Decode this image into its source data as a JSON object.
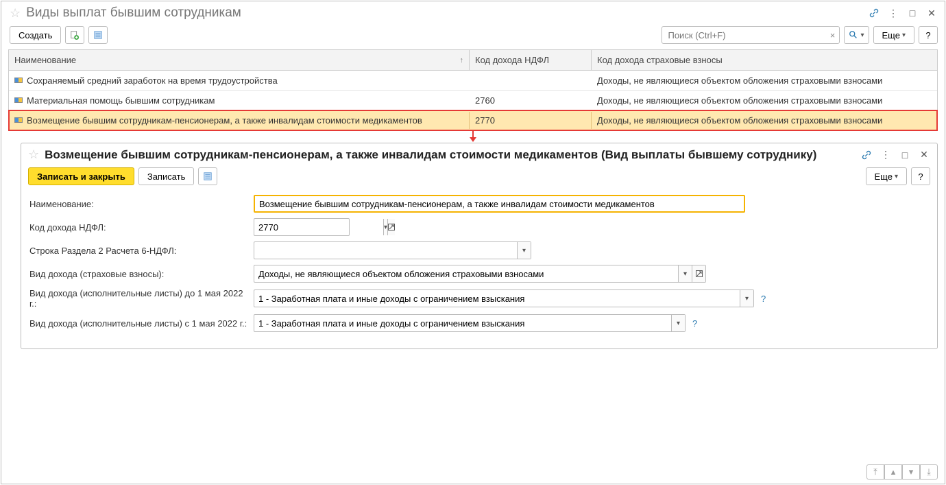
{
  "window": {
    "title": "Виды выплат бывшим сотрудникам",
    "create_label": "Создать",
    "search_placeholder": "Поиск (Ctrl+F)",
    "more_label": "Еще"
  },
  "table": {
    "headers": {
      "name": "Наименование",
      "ndfl": "Код дохода НДФЛ",
      "ins": "Код дохода страховые взносы"
    },
    "rows": [
      {
        "name": "Сохраняемый средний заработок на время трудоустройства",
        "ndfl": "",
        "ins": "Доходы, не являющиеся объектом обложения страховыми взносами"
      },
      {
        "name": "Материальная помощь бывшим сотрудникам",
        "ndfl": "2760",
        "ins": "Доходы, не являющиеся объектом обложения страховыми взносами"
      },
      {
        "name": "Возмещение бывшим сотрудникам-пенсионерам, а также инвалидам стоимости медикаментов",
        "ndfl": "2770",
        "ins": "Доходы, не являющиеся объектом обложения страховыми взносами"
      }
    ]
  },
  "detail": {
    "title": "Возмещение бывшим сотрудникам-пенсионерам, а также инвалидам стоимости медикаментов (Вид выплаты бывшему сотруднику)",
    "save_close": "Записать и закрыть",
    "save": "Записать",
    "more_label": "Еще",
    "fields": {
      "name_label": "Наименование:",
      "name_value": "Возмещение бывшим сотрудникам-пенсионерам, а также инвалидам стоимости медикаментов",
      "ndfl_label": "Код дохода НДФЛ:",
      "ndfl_value": "2770",
      "section2_label": "Строка Раздела 2 Расчета 6-НДФЛ:",
      "section2_value": "",
      "ins_label": "Вид дохода (страховые взносы):",
      "ins_value": "Доходы, не являющиеся объектом обложения страховыми взносами",
      "exec_before_label": "Вид дохода (исполнительные листы) до 1 мая 2022 г.:",
      "exec_before_value": "1 - Заработная плата и иные доходы с ограничением взыскания",
      "exec_after_label": "Вид дохода (исполнительные листы) с 1 мая 2022 г.:",
      "exec_after_value": "1 - Заработная плата и иные доходы с ограничением взыскания"
    }
  }
}
